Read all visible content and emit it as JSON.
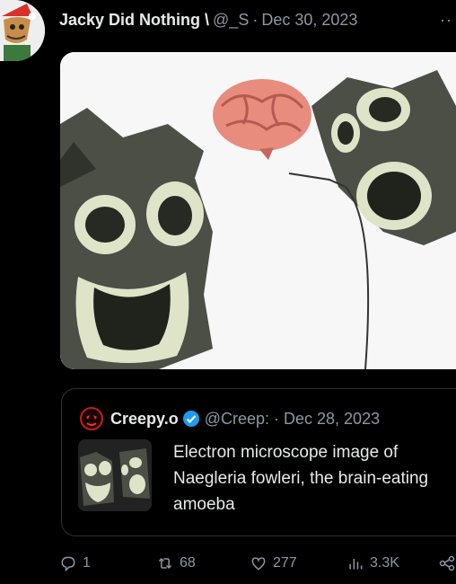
{
  "tweet": {
    "author_name": "Jacky Did Nothing \\",
    "handle": "@_S",
    "separator": "·",
    "date": "Dec 30, 2023",
    "more_label": "··"
  },
  "quote": {
    "author_name": "Creepy.o",
    "handle": "@Creep:",
    "separator": "·",
    "date": "Dec 28, 2023",
    "text": "Electron microscope image of Naegleria fowleri, the brain-eating amoeba"
  },
  "actions": {
    "replies": "1",
    "retweets": "68",
    "likes": "277",
    "views": "3.3K"
  },
  "icons": {
    "reply": "reply-icon",
    "retweet": "retweet-icon",
    "like": "heart-icon",
    "views": "views-icon",
    "share": "share-icon",
    "verified": "verified-badge-icon"
  },
  "colors": {
    "background": "#000000",
    "text": "#e7e9ea",
    "muted": "#8b98a5",
    "verified": "#1d9bf0"
  }
}
